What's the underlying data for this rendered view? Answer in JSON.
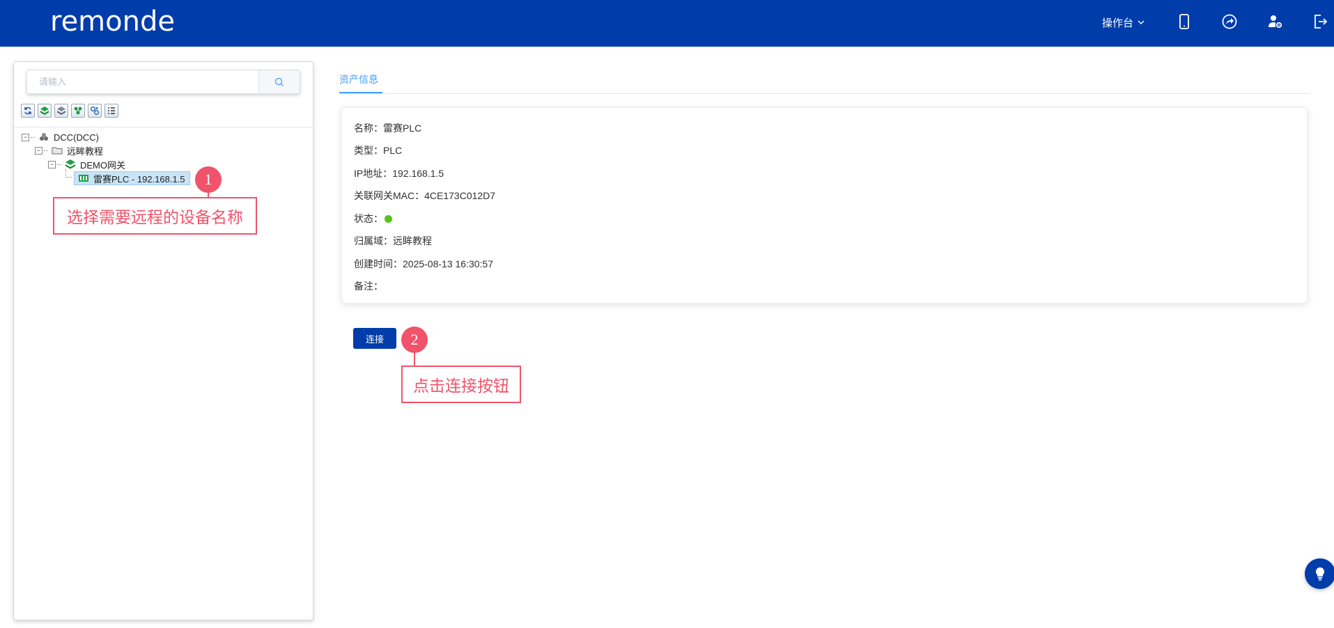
{
  "header": {
    "logo_text": "remonde",
    "console_menu": "操作台",
    "icons": [
      "mobile-icon",
      "share-icon",
      "user-settings-icon",
      "logout-icon"
    ]
  },
  "sidebar": {
    "search_placeholder": "请输入",
    "toolbar_icons": [
      "refresh-icon",
      "layers-green-icon",
      "layers-gray-icon",
      "network-green-icon",
      "settings-cluster-icon",
      "list-icon"
    ],
    "tree": [
      {
        "label": "DCC(DCC)",
        "icon": "cloud-cluster-icon",
        "level": 0,
        "expanded": true
      },
      {
        "label": "远眸教程",
        "icon": "folder-icon",
        "level": 1,
        "expanded": true
      },
      {
        "label": "DEMO网关",
        "icon": "gateway-icon",
        "level": 2,
        "expanded": true
      },
      {
        "label": "雷赛PLC - 192.168.1.5",
        "icon": "plc-icon",
        "level": 3,
        "selected": true
      }
    ]
  },
  "annotations": {
    "step1_number": "1",
    "step1_text": "选择需要远程的设备名称",
    "step2_number": "2",
    "step2_text": "点击连接按钮"
  },
  "main": {
    "tab_label": "资产信息",
    "info": [
      {
        "label": "名称：",
        "value": "雷赛PLC"
      },
      {
        "label": "类型：",
        "value": "PLC"
      },
      {
        "label": "IP地址：",
        "value": "192.168.1.5"
      },
      {
        "label": "关联网关MAC：",
        "value": "4CE173C012D7"
      },
      {
        "label": "状态：",
        "value": "",
        "status_color": "#52c41a"
      },
      {
        "label": "归属域：",
        "value": "远眸教程"
      },
      {
        "label": "创建时间：",
        "value": "2025-08-13 16:30:57"
      },
      {
        "label": "备注：",
        "value": ""
      }
    ],
    "connect_button": "连接"
  },
  "colors": {
    "brand": "#003dab",
    "accent": "#409eff",
    "annotation": "#f0536a",
    "status_online": "#52c41a"
  }
}
